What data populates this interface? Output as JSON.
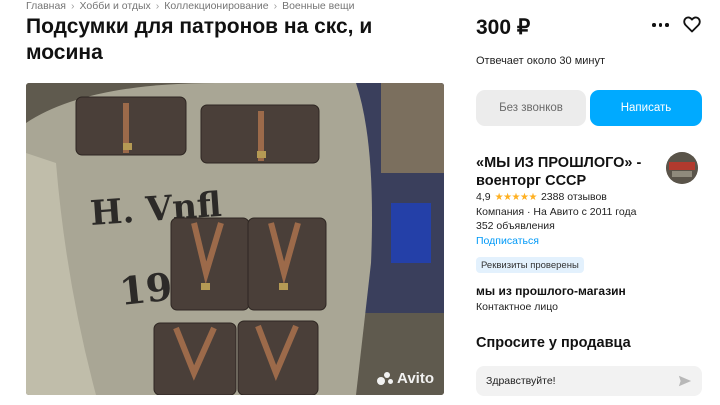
{
  "breadcrumbs": [
    "Главная",
    "Хобби и отдых",
    "Коллекционирование",
    "Военные вещи"
  ],
  "title": "Подсумки для патронов на скс, и мосина",
  "photo": {
    "watermark": "Avito"
  },
  "price": "300 ₽",
  "reply_time": "Отвечает около 30 минут",
  "buttons": {
    "no_calls": "Без звонков",
    "write": "Написать"
  },
  "seller": {
    "name": "«МЫ ИЗ ПРОШЛОГО» - военторг СССР",
    "rating": "4,9",
    "reviews": "2388 отзывов",
    "company": "Компания · На Авито с 2011 года",
    "ads": "352 объявления",
    "subscribe": "Подписаться",
    "badge": "Реквизиты проверены"
  },
  "shop": {
    "name": "мы из прошлого-магазин",
    "role": "Контактное лицо"
  },
  "ask": {
    "title": "Спросите у продавца",
    "message": "Здравствуйте!"
  },
  "colors": {
    "accent": "#00aaff",
    "star": "#ffb021",
    "link": "#0099f7",
    "badge_bg": "#e3f1fd"
  }
}
